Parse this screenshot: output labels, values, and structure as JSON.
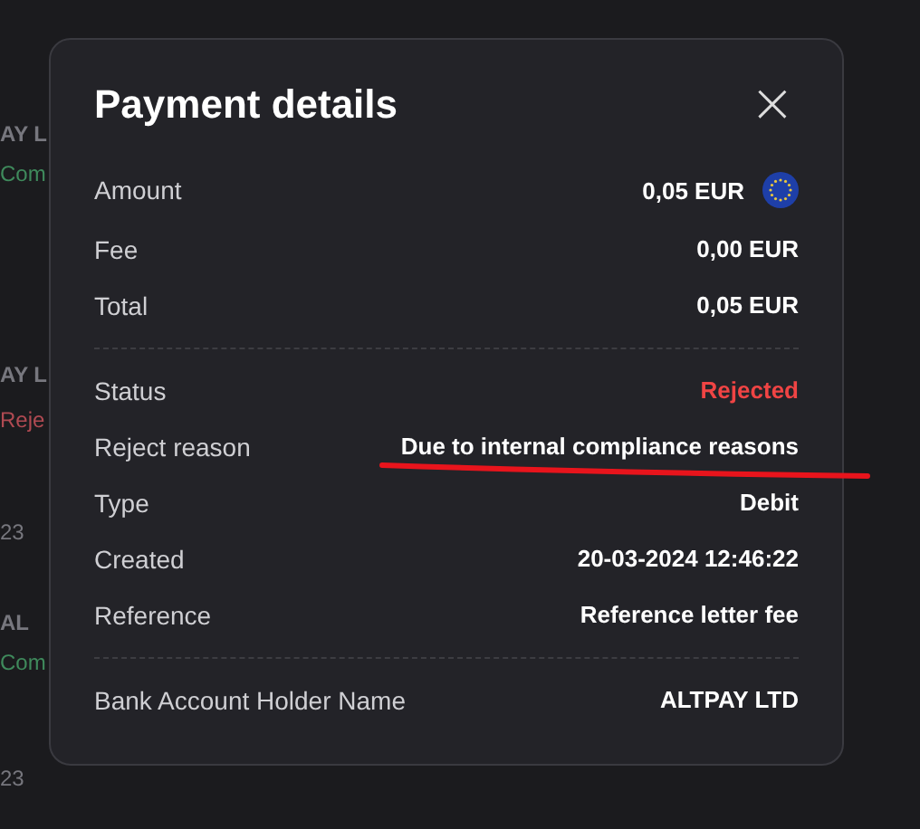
{
  "background_list": [
    {
      "text": "AY L",
      "kind": "name"
    },
    {
      "text": "Com",
      "kind": "completed"
    },
    {
      "text": "AY L",
      "kind": "name"
    },
    {
      "text": "Reje",
      "kind": "rejected"
    },
    {
      "text": "23",
      "kind": "date"
    },
    {
      "text": "AL",
      "kind": "name"
    },
    {
      "text": "Com",
      "kind": "completed"
    },
    {
      "text": "23",
      "kind": "date"
    }
  ],
  "dialog": {
    "title": "Payment details",
    "close": "×",
    "sections": [
      [
        {
          "label": "Amount",
          "value": "0,05 EUR",
          "kind": "amount",
          "underlined": false
        },
        {
          "label": "Fee",
          "value": "0,00 EUR",
          "kind": "plain",
          "underlined": false
        },
        {
          "label": "Total",
          "value": "0,05 EUR",
          "kind": "plain",
          "underlined": false
        }
      ],
      [
        {
          "label": "Status",
          "value": "Rejected",
          "kind": "status",
          "underlined": false
        },
        {
          "label": "Reject reason",
          "value": "Due to internal compliance reasons",
          "kind": "plain",
          "underlined": true
        },
        {
          "label": "Type",
          "value": "Debit",
          "kind": "plain",
          "underlined": false
        },
        {
          "label": "Created",
          "value": "20-03-2024 12:46:22",
          "kind": "plain",
          "underlined": false
        },
        {
          "label": "Reference",
          "value": "Reference letter fee",
          "kind": "plain",
          "underlined": false
        }
      ],
      [
        {
          "label": "Bank Account Holder Name",
          "value": "ALTPAY LTD",
          "kind": "plain",
          "underlined": false
        }
      ]
    ]
  }
}
